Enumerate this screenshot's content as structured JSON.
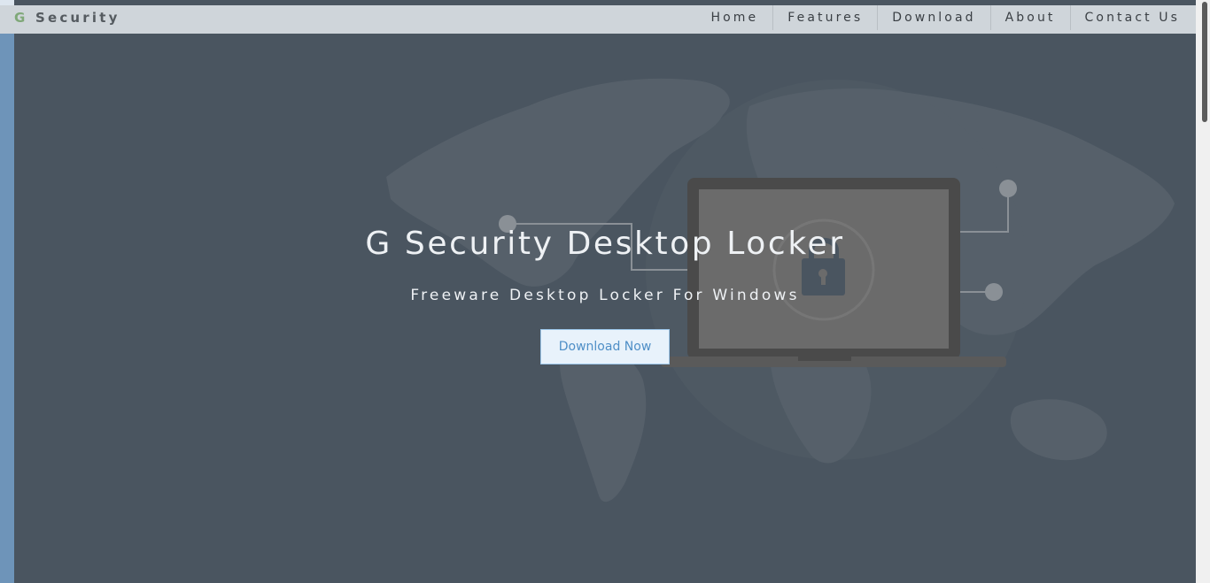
{
  "navbar": {
    "brand_initial": "G",
    "brand_rest": "Security",
    "items": [
      {
        "label": "Home"
      },
      {
        "label": "Features"
      },
      {
        "label": "Download"
      },
      {
        "label": "About"
      },
      {
        "label": "Contact Us"
      }
    ]
  },
  "hero": {
    "title": "G Security Desktop Locker",
    "subtitle": "Freeware Desktop Locker For Windows",
    "cta_label": "Download Now"
  },
  "colors": {
    "hero_background": "#4a5560",
    "navbar_background": "#cfd5da",
    "brand_accent": "#7fa878",
    "page_side": "#6e94b9",
    "cta_text": "#4f8fc7"
  },
  "icons": [
    "world-map-illustration",
    "laptop-illustration",
    "padlock-icon"
  ]
}
